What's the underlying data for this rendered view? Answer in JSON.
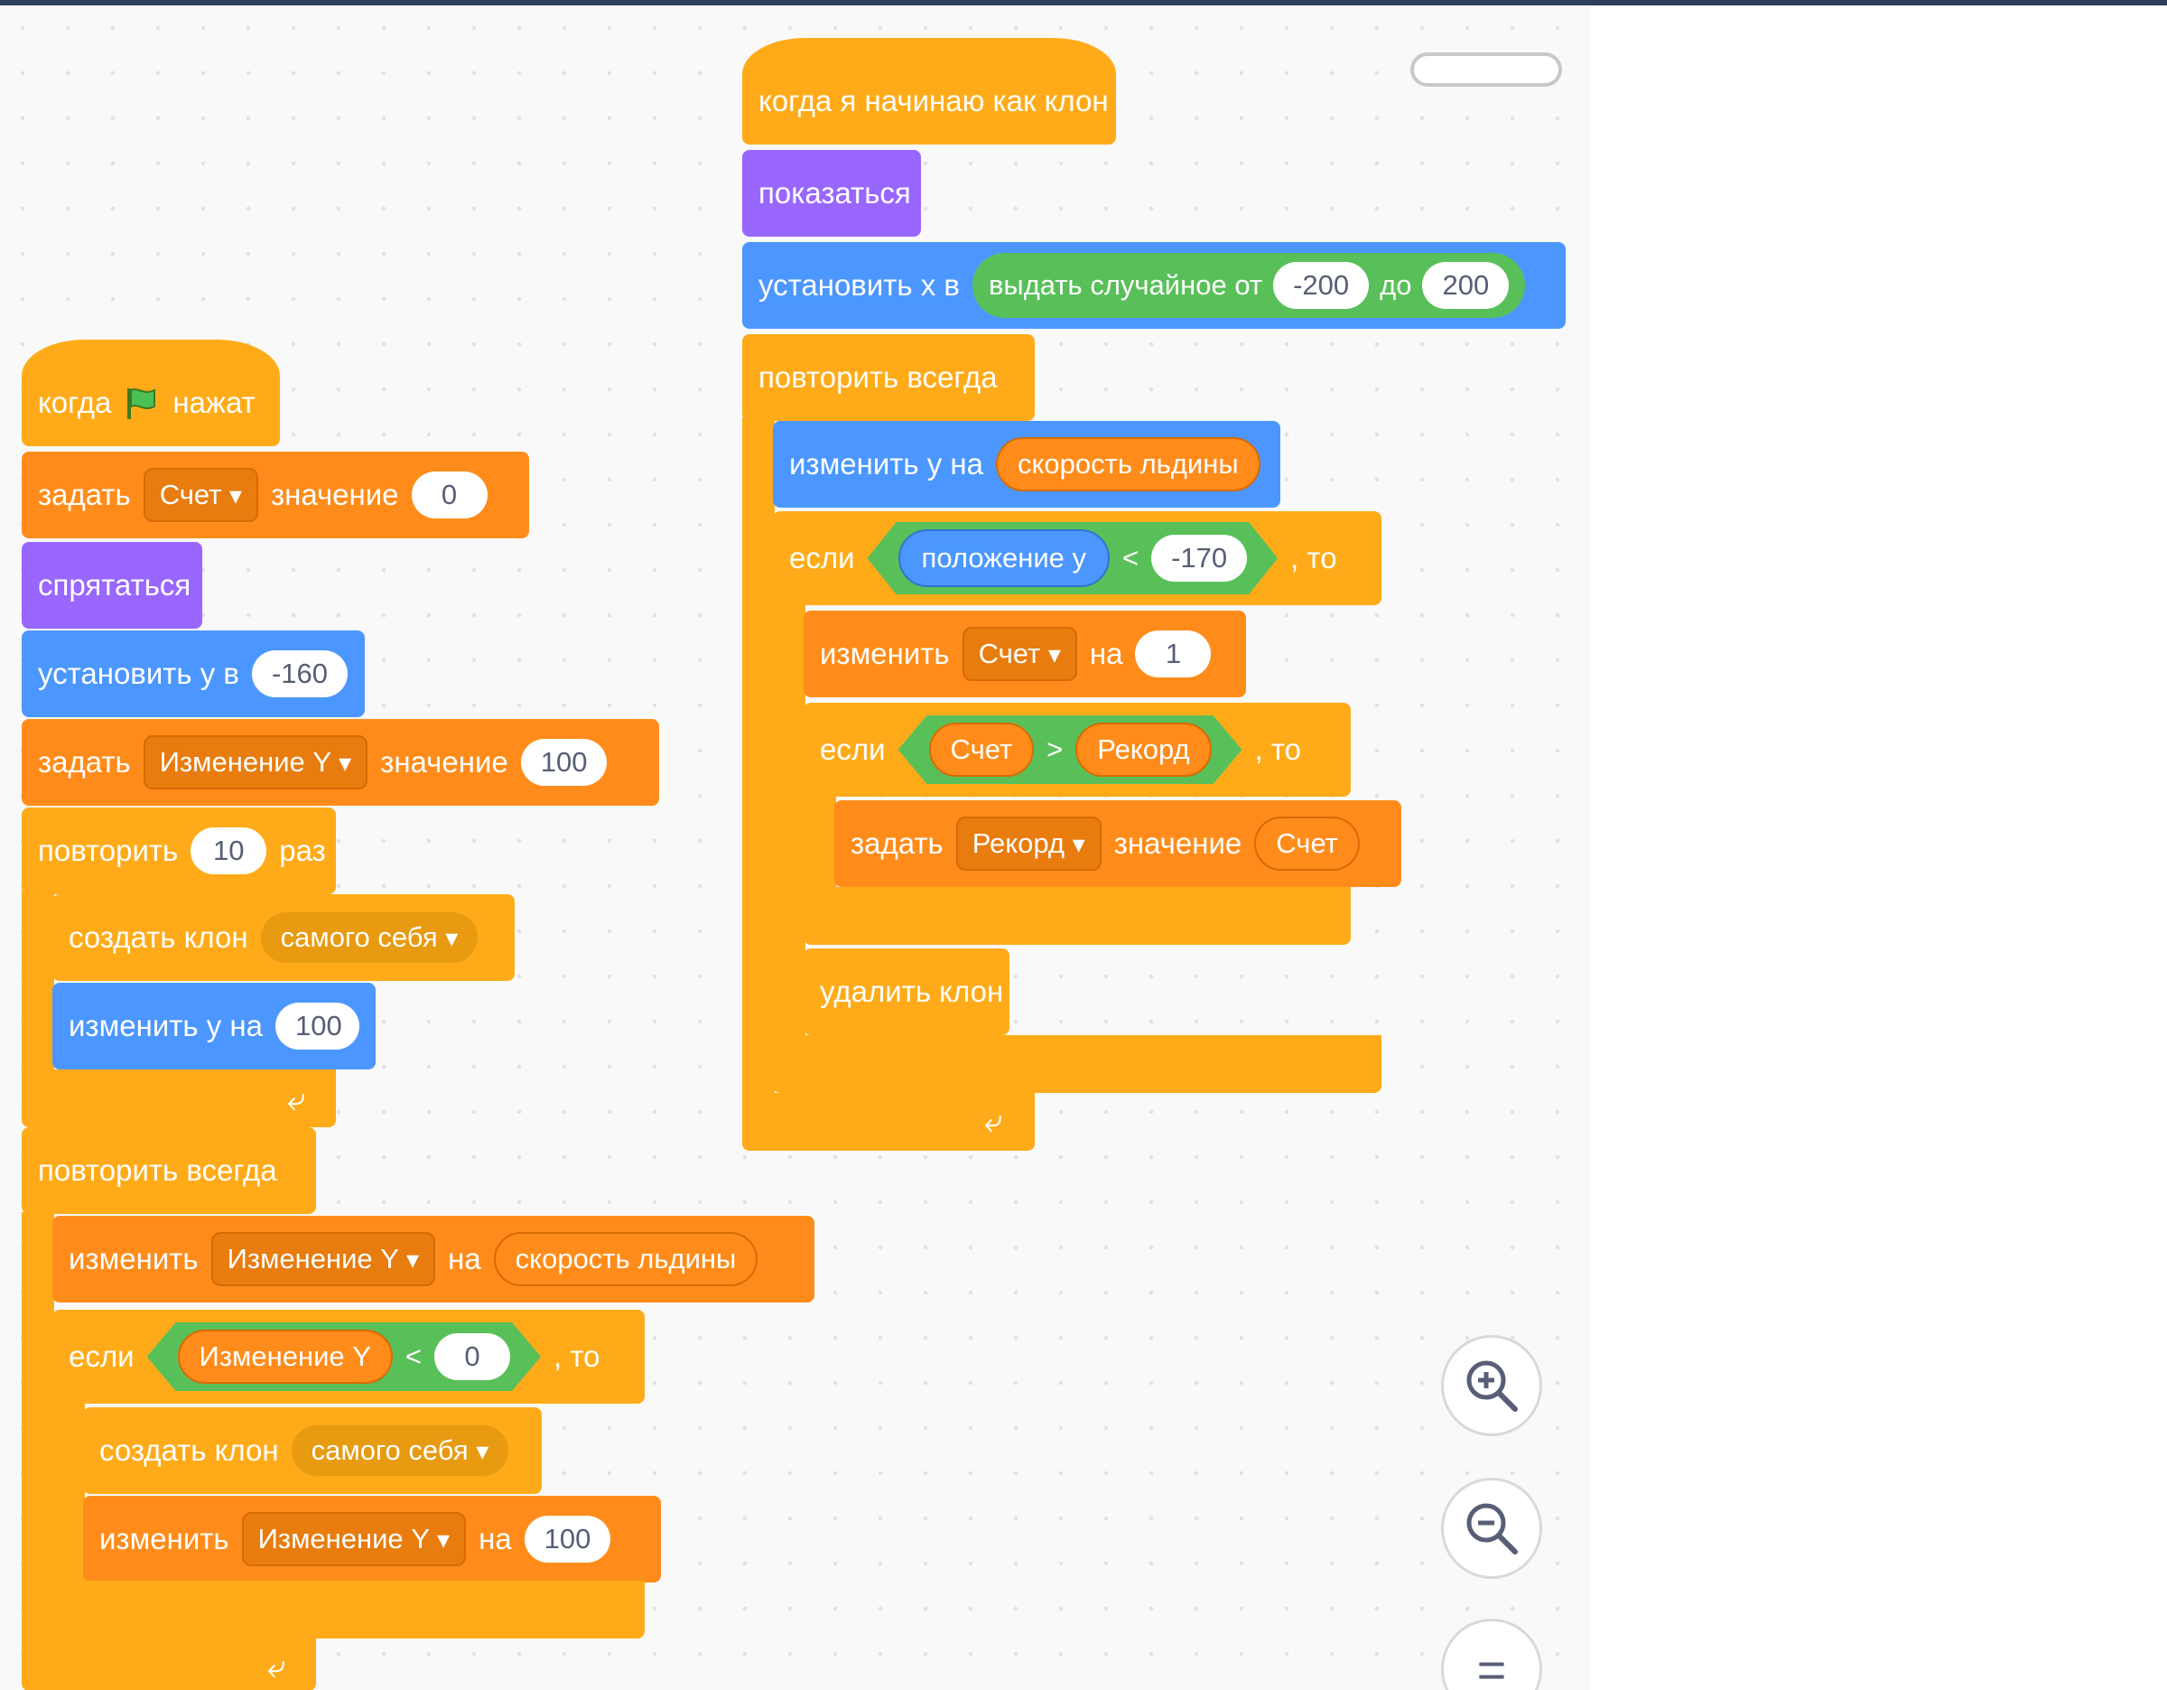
{
  "colors": {
    "events": "#ffab19",
    "control": "#ffab19",
    "variables": "#ff8c1a",
    "looks": "#9966ff",
    "motion": "#4c97ff",
    "operators": "#59c059"
  },
  "icons": {
    "flag": "green-flag-icon",
    "loop": "loop-arrow-icon",
    "zoom_in": "zoom-in-icon",
    "zoom_out": "zoom-out-icon",
    "reset": "zoom-reset-icon",
    "dropdown": "dropdown-arrow-icon"
  },
  "left": {
    "hat_a": "когда",
    "hat_b": "нажат",
    "set1_a": "задать",
    "set1_var": "Счет",
    "set1_b": "значение",
    "set1_val": "0",
    "hide": "спрятаться",
    "sety_label": "установить у в",
    "sety_val": "-160",
    "set2_a": "задать",
    "set2_var": "Изменение Y",
    "set2_b": "значение",
    "set2_val": "100",
    "repeat_a": "повторить",
    "repeat_n": "10",
    "repeat_b": "раз",
    "clone1_label": "создать клон",
    "clone1_target": "самого себя",
    "changey_label": "изменить у на",
    "changey_val": "100",
    "forever": "повторить всегда",
    "ch1_a": "изменить",
    "ch1_var": "Изменение Y",
    "ch1_b": "на",
    "ch1_rep": "скорость льдины",
    "if_a": "если",
    "if_rep": "Изменение Y",
    "if_op": "<",
    "if_val": "0",
    "if_then": ", то",
    "clone2_label": "создать клон",
    "clone2_target": "самого себя",
    "ch2_a": "изменить",
    "ch2_var": "Изменение Y",
    "ch2_b": "на",
    "ch2_val": "100"
  },
  "right": {
    "hat": "когда я начинаю как клон",
    "show": "показаться",
    "setx_label": "установить х в",
    "rand_a": "выдать случайное от",
    "rand_min": "-200",
    "rand_to": "до",
    "rand_max": "200",
    "forever": "повторить всегда",
    "changey_label": "изменить у на",
    "changey_rep": "скорость льдины",
    "if1_a": "если",
    "if1_rep": "положение у",
    "if1_op": "<",
    "if1_val": "-170",
    "if1_then": ", то",
    "ch_a": "изменить",
    "ch_var": "Счет",
    "ch_b": "на",
    "ch_val": "1",
    "if2_a": "если",
    "if2_l": "Счет",
    "if2_op": ">",
    "if2_r": "Рекорд",
    "if2_then": ", то",
    "set_a": "задать",
    "set_var": "Рекорд",
    "set_b": "значение",
    "set_rep": "Счет",
    "del": "удалить клон"
  },
  "zoom": {
    "reset_glyph": "="
  }
}
